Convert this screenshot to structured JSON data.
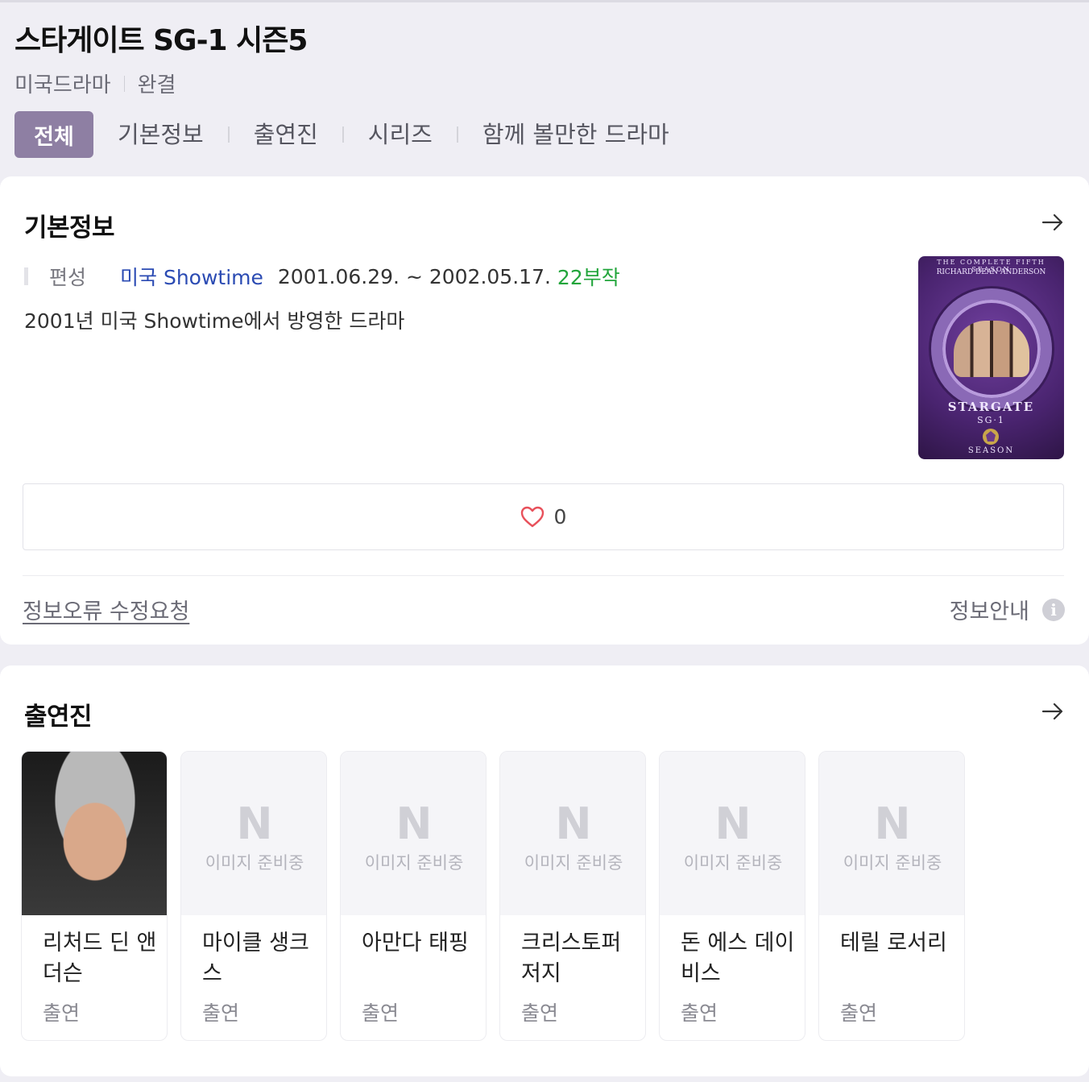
{
  "header": {
    "title": "스타게이트 SG-1 시즌5",
    "genre": "미국드라마",
    "status": "완결"
  },
  "tabs": [
    {
      "label": "전체",
      "active": true
    },
    {
      "label": "기본정보"
    },
    {
      "label": "출연진"
    },
    {
      "label": "시리즈"
    },
    {
      "label": "함께 볼만한 드라마"
    }
  ],
  "basic_info": {
    "title": "기본정보",
    "label": "편성",
    "channel": "미국 Showtime",
    "dates": "2001.06.29. ~ 2002.05.17.",
    "episodes": "22부작",
    "description": "2001년 미국 Showtime에서 방영한 드라마",
    "poster": {
      "top_line": "THE COMPLETE FIFTH SEASON",
      "actor_line": "RICHARD DEAN ANDERSON",
      "logo": "STARGATE",
      "logo_sub": "SG·1",
      "season": "SEASON"
    },
    "likes": "0",
    "fix_request": "정보오류 수정요청",
    "info_guide": "정보안내"
  },
  "cast": {
    "title": "출연진",
    "no_image_text": "이미지 준비중",
    "members": [
      {
        "name": "리처드 딘 앤더슨",
        "role": "출연",
        "has_photo": true
      },
      {
        "name": "마이클 생크스",
        "role": "출연",
        "has_photo": false
      },
      {
        "name": "아만다 태핑",
        "role": "출연",
        "has_photo": false
      },
      {
        "name": "크리스토퍼 저지",
        "role": "출연",
        "has_photo": false
      },
      {
        "name": "돈 에스 데이비스",
        "role": "출연",
        "has_photo": false
      },
      {
        "name": "테릴 로서리",
        "role": "출연",
        "has_photo": false
      }
    ]
  },
  "colors": {
    "accent": "#8e7fa3",
    "channel": "#2b4bb3",
    "episodes": "#22a53b",
    "heart": "#e8515b"
  }
}
